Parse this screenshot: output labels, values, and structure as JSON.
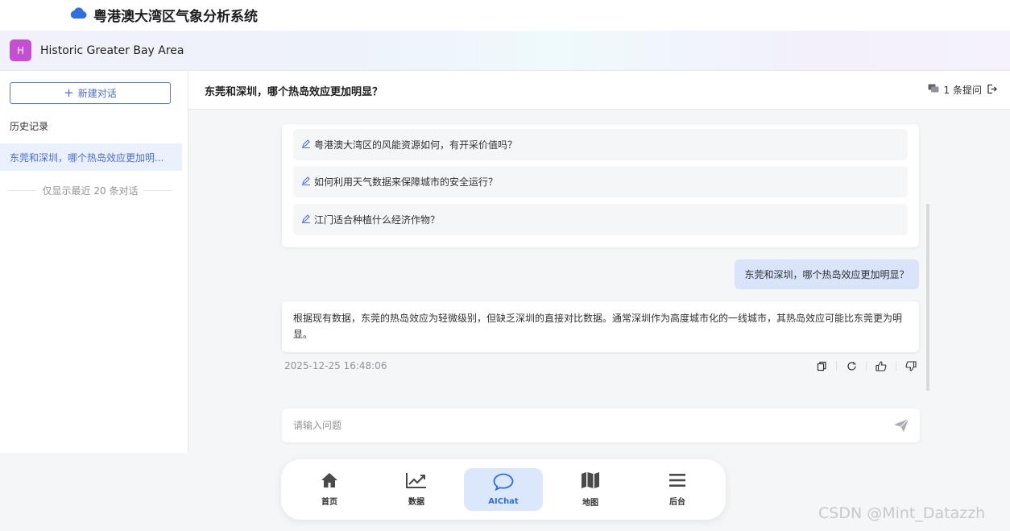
{
  "app": {
    "title": "粤港澳大湾区气象分析系统"
  },
  "agent": {
    "avatar_letter": "H",
    "name": "Historic Greater Bay Area"
  },
  "sidebar": {
    "new_chat_label": "新建对话",
    "history_title": "历史记录",
    "history_items": [
      "东莞和深圳，哪个热岛效应更加明..."
    ],
    "history_note": "仅显示最近 20 条对话"
  },
  "conversation": {
    "title": "东莞和深圳，哪个热岛效应更加明显？",
    "question_count": "1 条提问",
    "suggestions": [
      "粤港澳大湾区的风能资源如何，有开采价值吗？",
      "如何利用天气数据来保障城市的安全运行？",
      "江门适合种植什么经济作物？"
    ],
    "user_message": "东莞和深圳，哪个热岛效应更加明显？",
    "answer": "根据现有数据，东莞的热岛效应为轻微级别，但缺乏深圳的直接对比数据。通常深圳作为高度城市化的一线城市，其热岛效应可能比东莞更为明显。",
    "answer_time": "2025-12-25 16:48:06"
  },
  "input": {
    "placeholder": "请输入问题"
  },
  "bottom_nav": [
    {
      "label": "首页",
      "icon": "home-icon"
    },
    {
      "label": "数据",
      "icon": "line-chart-icon"
    },
    {
      "label": "AIChat",
      "icon": "chat-bubble-icon"
    },
    {
      "label": "地图",
      "icon": "map-icon"
    },
    {
      "label": "后台",
      "icon": "menu-icon"
    }
  ],
  "watermark": "CSDN @Mint_Datazzh",
  "colors": {
    "accent": "#2f6fe0",
    "avatar": "#c64fd1",
    "user_bubble": "#d9e4fa",
    "active_nav": "#dbe7fb"
  }
}
